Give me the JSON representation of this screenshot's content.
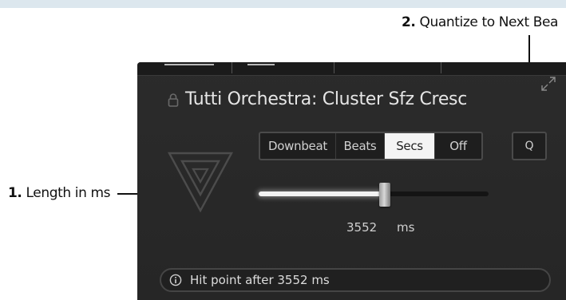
{
  "callouts": {
    "quantize": {
      "number": "2.",
      "text": "Quantize to Next Bea"
    },
    "length": {
      "number": "1.",
      "text": "Length in ms"
    }
  },
  "panel": {
    "title": "Tutti Orchestra: Cluster Sfz Cresc",
    "modes": [
      {
        "label": "Downbeat",
        "active": false
      },
      {
        "label": "Beats",
        "active": false
      },
      {
        "label": "Secs",
        "active": true
      },
      {
        "label": "Off",
        "active": false
      }
    ],
    "quantize_label": "Q",
    "slider": {
      "fraction": 0.55
    },
    "readout": {
      "value": "3552",
      "unit": "ms"
    },
    "info": "Hit point after 3552 ms"
  },
  "colors": {
    "panel_bg": "#2b2b2b",
    "active_segment": "#f4f4f4",
    "text": "#e6e6e6"
  },
  "icons": [
    "lock-icon",
    "expand-icon",
    "logo-icon",
    "info-icon"
  ]
}
